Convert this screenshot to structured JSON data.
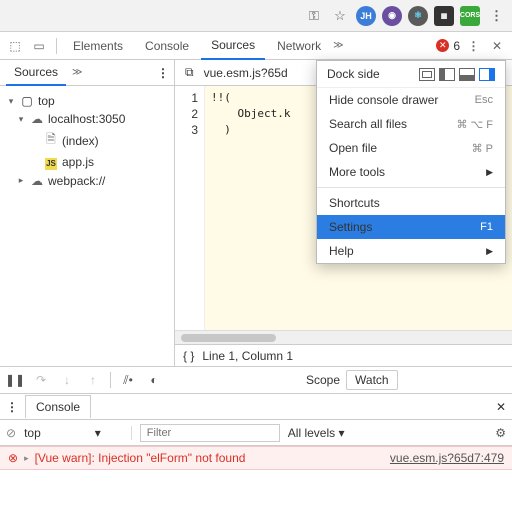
{
  "chrome": {
    "ext_jh": "JH",
    "ext_cors": "CORS"
  },
  "devtools": {
    "tabs": [
      "Elements",
      "Console",
      "Sources",
      "Network"
    ],
    "active_tab": 2,
    "error_count": "6"
  },
  "sources": {
    "panel_label": "Sources",
    "open_file": "vue.esm.js?65d",
    "tree": {
      "top": "top",
      "host": "localhost:3050",
      "index": "(index)",
      "appjs": "app.js",
      "webpack": "webpack://"
    },
    "code": {
      "lines": [
        "1",
        "2",
        "3"
      ],
      "text": "!!(\n    Object.k\n  )"
    },
    "status": "Line 1, Column 1"
  },
  "debugger": {
    "scope_label": "Scope",
    "watch_label": "Watch"
  },
  "console_drawer": {
    "tab": "Console",
    "context": "top",
    "filter_placeholder": "Filter",
    "levels": "All levels",
    "message": "[Vue warn]: Injection \"elForm\" not found",
    "link": "vue.esm.js?65d7:479"
  },
  "menu": {
    "dock_label": "Dock side",
    "items": {
      "hide_console": "Hide console drawer",
      "hide_console_sc": "Esc",
      "search": "Search all files",
      "search_sc": "⌘ ⌥ F",
      "open": "Open file",
      "open_sc": "⌘ P",
      "more_tools": "More tools",
      "shortcuts": "Shortcuts",
      "settings": "Settings",
      "settings_sc": "F1",
      "help": "Help"
    }
  }
}
